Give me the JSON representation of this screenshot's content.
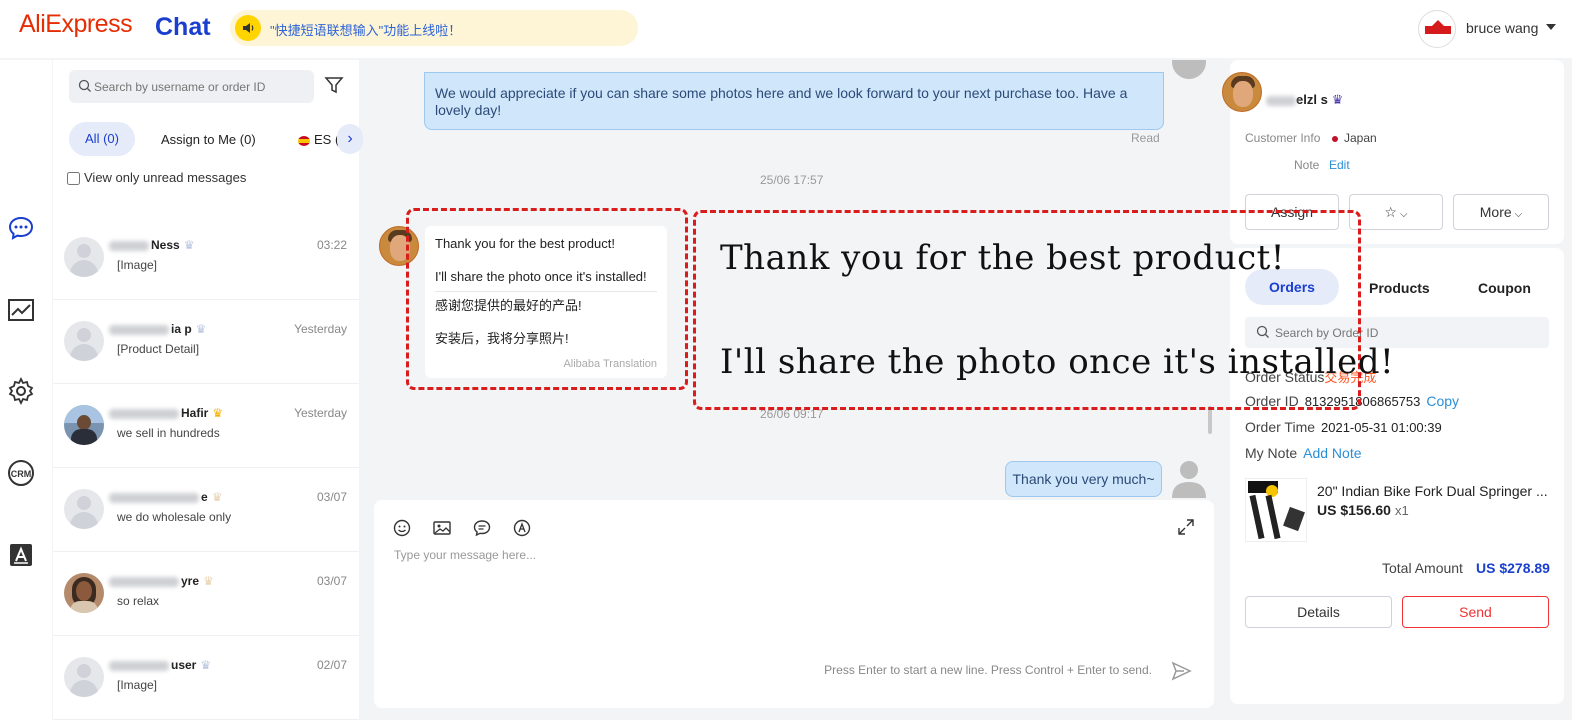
{
  "header": {
    "logo_text": "AliExpress",
    "chat_label": "Chat",
    "announcement": "\"快捷短语联想输入\"功能上线啦！",
    "user_name": "bruce wang"
  },
  "sidebar": {
    "search_placeholder": "Search by username or order ID",
    "tabs": [
      {
        "label": "All (0)"
      },
      {
        "label": "Assign to Me (0)"
      },
      {
        "label": "ES ("
      }
    ],
    "unread_label": "View only unread messages",
    "conversations": [
      {
        "name": "Ness",
        "time": "03:22",
        "preview": "[Image]"
      },
      {
        "name": "ia p",
        "time": "Yesterday",
        "preview": "[Product Detail]"
      },
      {
        "name": "Hafir",
        "time": "Yesterday",
        "preview": "we sell in hundreds"
      },
      {
        "name": "e",
        "time": "03/07",
        "preview": "we do wholesale only"
      },
      {
        "name": "yre",
        "time": "03/07",
        "preview": "so relax"
      },
      {
        "name": "user",
        "time": "02/07",
        "preview": "[Image]"
      }
    ]
  },
  "chat": {
    "top_message": "We would appreciate if you can share some photos here and we look forward to your next purchase too. Have a lovely day!",
    "read_label": "Read",
    "timestamp_1": "25/06 17:57",
    "incoming_line1": "Thank you for the best product!",
    "incoming_line2": "I'll share the photo once it's installed!",
    "translated_line1": "感谢您提供的最好的产品!",
    "translated_line2": "安装后，我将分享照片!",
    "translation_label": "Alibaba Translation",
    "annotation_line1": "Thank you for the best product!",
    "annotation_line2": "I'll share the photo once it's installed!",
    "timestamp_2": "26/06 09:17",
    "outgoing_message": "Thank you very much~",
    "composer_placeholder": "Type your message here...",
    "composer_hint": "Press Enter to start a new line. Press Control + Enter to send."
  },
  "customer": {
    "name": "elzl s",
    "info_label": "Customer Info",
    "country": "Japan",
    "note_label": "Note",
    "edit_label": "Edit",
    "assign_label": "Assign",
    "more_label": "More"
  },
  "orders": {
    "tabs": [
      "Orders",
      "Products",
      "Coupon"
    ],
    "search_placeholder": "Search by Order ID",
    "status_label": "Order Status",
    "status_value": "交易完成",
    "order_id_label": "Order ID",
    "order_id": "8132951806865753",
    "copy_label": "Copy",
    "order_time_label": "Order Time",
    "order_time": "2021-05-31 01:00:39",
    "my_note_label": "My Note",
    "add_note_label": "Add Note",
    "product_title": "20\" Indian Bike Fork Dual Springer ...",
    "product_price": "US $156.60",
    "product_qty": "x1",
    "total_label": "Total Amount",
    "total_value": "US $278.89",
    "details_label": "Details",
    "send_label": "Send"
  },
  "colors": {
    "brand_red": "#e62e04",
    "brand_blue": "#1a3fcf",
    "link_blue": "#2b8fd6",
    "annotation_red": "#d91c1c",
    "status_orange": "#ff5722"
  }
}
